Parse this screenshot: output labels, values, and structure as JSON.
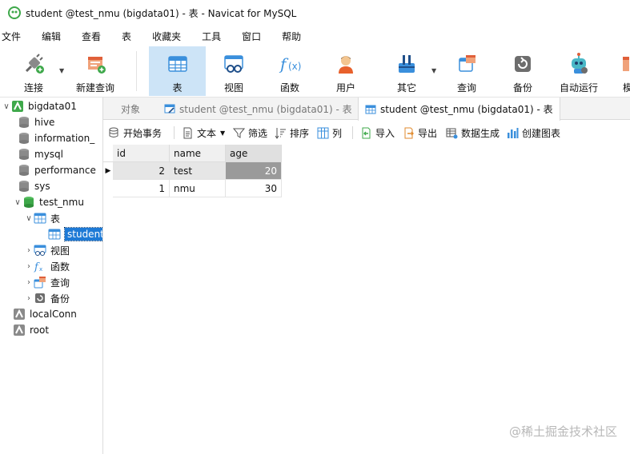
{
  "window": {
    "title": "student @test_nmu (bigdata01) - 表 - Navicat for MySQL"
  },
  "menu": [
    "文件",
    "编辑",
    "查看",
    "表",
    "收藏夹",
    "工具",
    "窗口",
    "帮助"
  ],
  "toolbar": {
    "items": [
      {
        "label": "连接",
        "icon": "plug-icon"
      },
      {
        "label": "新建查询",
        "icon": "new-query-icon"
      },
      {
        "label": "表",
        "icon": "table-icon",
        "active": true
      },
      {
        "label": "视图",
        "icon": "view-icon"
      },
      {
        "label": "函数",
        "icon": "function-icon"
      },
      {
        "label": "用户",
        "icon": "user-icon"
      },
      {
        "label": "其它",
        "icon": "tools-icon"
      },
      {
        "label": "查询",
        "icon": "query-icon"
      },
      {
        "label": "备份",
        "icon": "backup-icon"
      },
      {
        "label": "自动运行",
        "icon": "robot-icon"
      },
      {
        "label": "模",
        "icon": "model-icon"
      }
    ]
  },
  "navtree": {
    "connection": "bigdata01",
    "databases": [
      "hive",
      "information_",
      "mysql",
      "performance",
      "sys",
      "test_nmu"
    ],
    "test_nmu_children": {
      "tables_label": "表",
      "table": "student",
      "others": [
        "视图",
        "函数",
        "查询",
        "备份"
      ]
    },
    "other_connections": [
      "localConn",
      "root"
    ]
  },
  "tabs": [
    {
      "label": "对象"
    },
    {
      "label": "student @test_nmu (bigdata01) - 表"
    },
    {
      "label": "student @test_nmu (bigdata01) - 表",
      "active": true
    }
  ],
  "table_toolbar": {
    "begin_tx": "开始事务",
    "text": "文本",
    "filter": "筛选",
    "sort": "排序",
    "columns": "列",
    "import": "导入",
    "export": "导出",
    "data_gen": "数据生成",
    "create_chart": "创建图表"
  },
  "grid": {
    "columns": [
      "id",
      "name",
      "age"
    ],
    "rows": [
      {
        "id": "2",
        "name": "test",
        "age": "20",
        "current": true
      },
      {
        "id": "1",
        "name": "nmu",
        "age": "30"
      }
    ]
  },
  "watermark": "@稀土掘金技术社区",
  "colors": {
    "accent": "#1e7ad6",
    "toolbar_active": "#cde4f7",
    "selected_cell": "#9a9a9a"
  }
}
